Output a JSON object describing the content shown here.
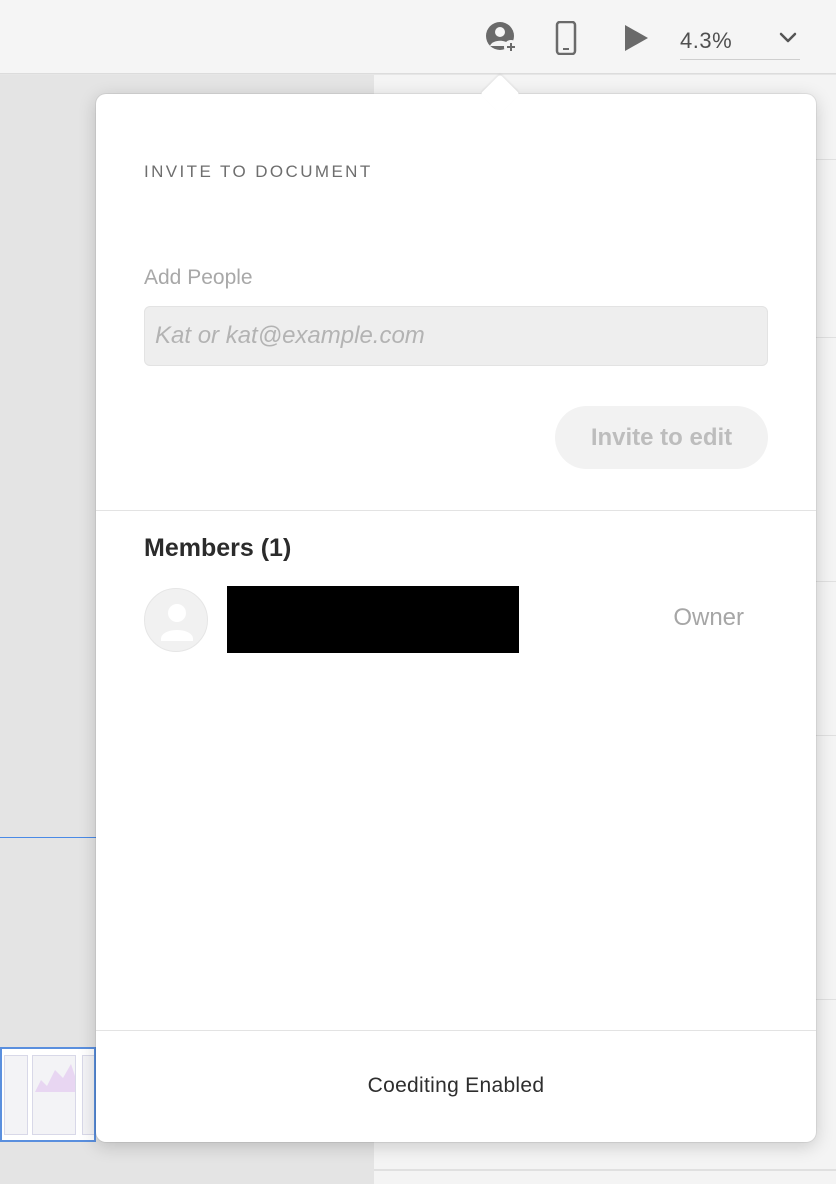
{
  "toolbar": {
    "share_icon": "user-add-icon",
    "device_icon": "mobile-device-icon",
    "play_icon": "play-icon",
    "zoom_value": "4.3%",
    "zoom_icon": "chevron-down-icon"
  },
  "popover": {
    "title": "INVITE TO DOCUMENT",
    "add_people_label": "Add People",
    "input": {
      "placeholder": "Kat or kat@example.com",
      "value": ""
    },
    "invite_button": "Invite to edit",
    "members_heading": "Members (1)",
    "members": [
      {
        "name": "",
        "role": "Owner",
        "avatar_icon": "default-user-icon"
      }
    ],
    "footer_status": "Coediting Enabled"
  },
  "colors": {
    "toolbar_bg": "#f5f5f5",
    "popover_bg": "#ffffff",
    "input_bg": "#eeeeee",
    "button_disabled_text": "#bdbdbd",
    "selection_blue": "#5a8fde"
  }
}
